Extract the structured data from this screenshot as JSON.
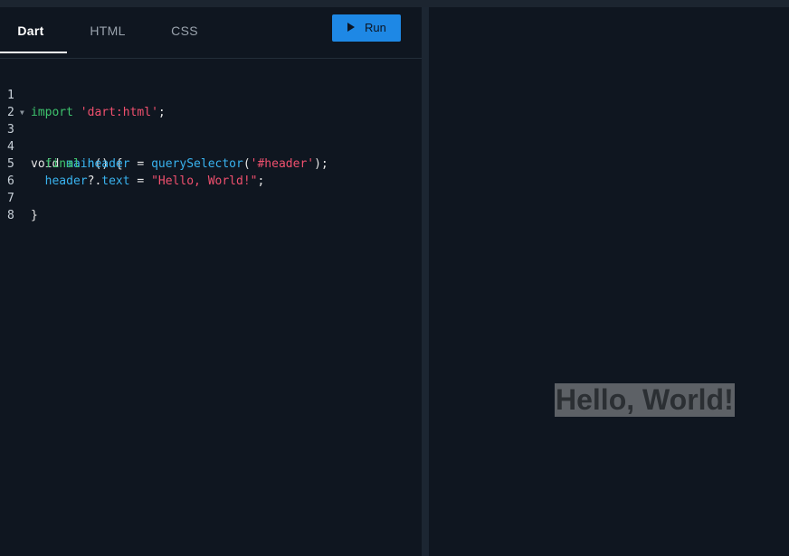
{
  "tabs": [
    {
      "label": "Dart",
      "active": true
    },
    {
      "label": "HTML",
      "active": false
    },
    {
      "label": "CSS",
      "active": false
    }
  ],
  "run_button": {
    "label": "Run",
    "icon": "play-icon",
    "color": "#1e88e5"
  },
  "code_lines": {
    "l1": {
      "n": "1",
      "a": "import",
      "b": " ",
      "c": "'dart:html'",
      "d": ";"
    },
    "l2": {
      "n": "2"
    },
    "l3": {
      "n": "3",
      "a": "void ",
      "b": "main",
      "c": "() {"
    },
    "l4": {
      "n": "4",
      "a": "  ",
      "b": "final ",
      "c": "header",
      "d": " = ",
      "e": "querySelector",
      "f": "(",
      "g": "'#header'",
      "h": ");"
    },
    "l5": {
      "n": "5",
      "a": "  ",
      "b": "header",
      "c": "?.",
      "d": "text",
      "e": " = ",
      "f": "\"Hello, World!\"",
      "g": ";"
    },
    "l6": {
      "n": "6"
    },
    "l7": {
      "n": "7",
      "a": "}"
    },
    "l8": {
      "n": "8"
    }
  },
  "preview": {
    "heading": "Hello, World!"
  }
}
